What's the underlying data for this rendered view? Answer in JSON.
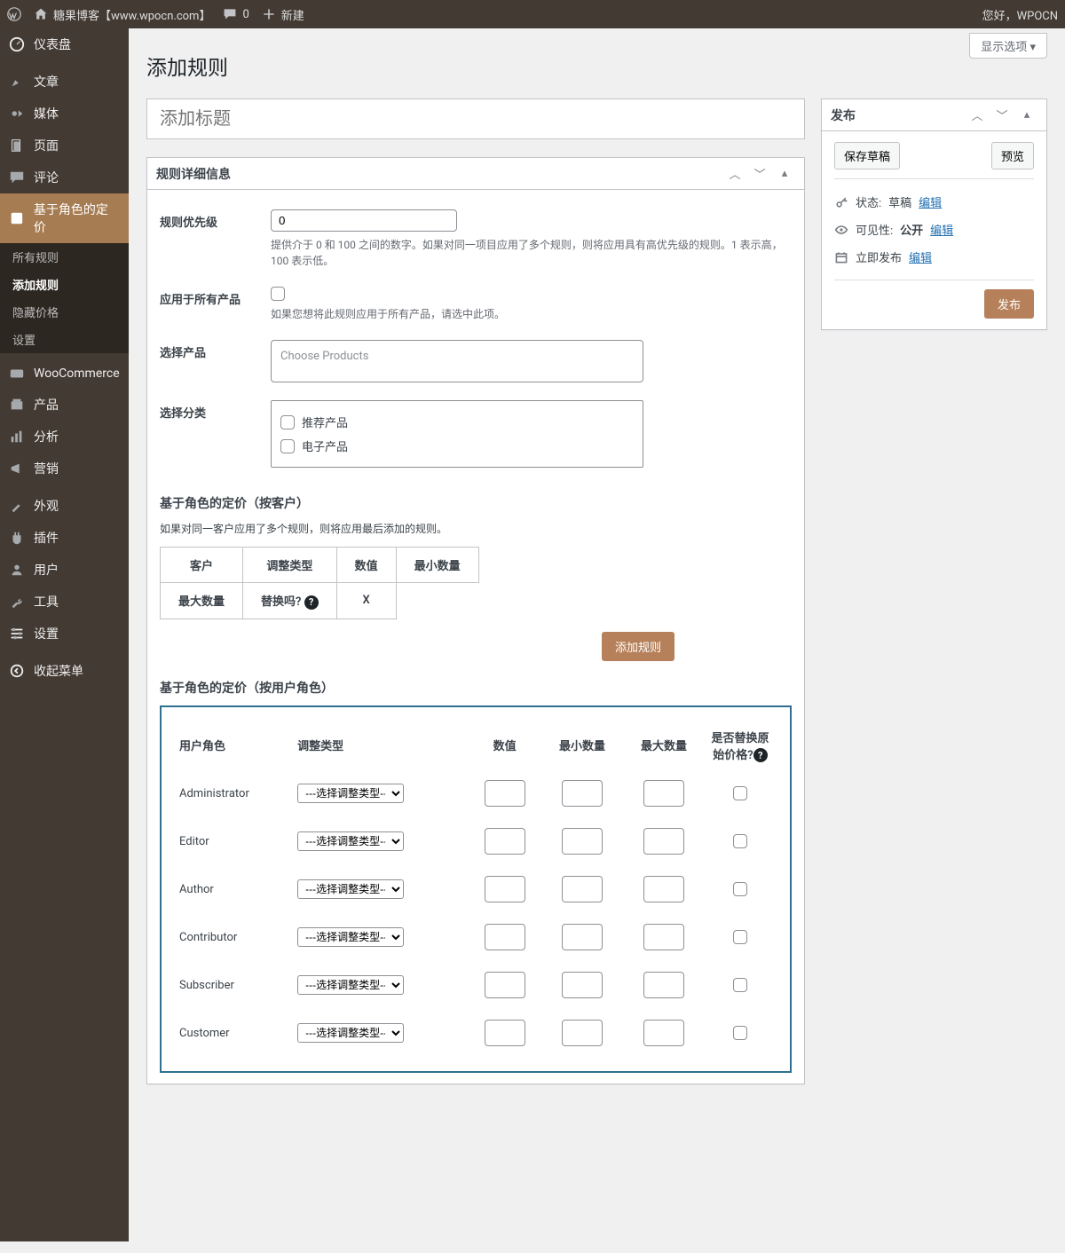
{
  "adminbar": {
    "site": "糖果博客【www.wpocn.com】",
    "comments": "0",
    "new": "新建",
    "hello": "您好，WPOCN"
  },
  "menu": {
    "dashboard": "仪表盘",
    "posts": "文章",
    "media": "媒体",
    "pages": "页面",
    "comments": "评论",
    "role_pricing": "基于角色的定价",
    "sub_all": "所有规则",
    "sub_add": "添加规则",
    "sub_hide": "隐藏价格",
    "sub_settings": "设置",
    "woocommerce": "WooCommerce",
    "products": "产品",
    "analytics": "分析",
    "marketing": "营销",
    "appearance": "外观",
    "plugins": "插件",
    "users": "用户",
    "tools": "工具",
    "settings": "设置",
    "collapse": "收起菜单"
  },
  "header": {
    "screen_options": "显示选项",
    "page_title": "添加规则",
    "title_placeholder": "添加标题"
  },
  "details": {
    "box_title": "规则详细信息",
    "priority_label": "规则优先级",
    "priority_value": "0",
    "priority_desc": "提供介于 0 和 100 之间的数字。如果对同一项目应用了多个规则，则将应用具有高优先级的规则。1 表示高，100 表示低。",
    "allprod_label": "应用于所有产品",
    "allprod_desc": "如果您想将此规则应用于所有产品，请选中此项。",
    "choose_prod_label": "选择产品",
    "choose_prod_placeholder": "Choose Products",
    "choose_cat_label": "选择分类",
    "cat1": "推荐产品",
    "cat2": "电子产品"
  },
  "by_customer": {
    "heading": "基于角色的定价（按客户）",
    "hint": "如果对同一客户应用了多个规则，则将应用最后添加的规则。",
    "col_customer": "客户",
    "col_adjtype": "调整类型",
    "col_value": "数值",
    "col_minqty": "最小数量",
    "col_maxqty": "最大数量",
    "col_replace": "替换吗?",
    "col_x": "X",
    "add_rule_btn": "添加规则"
  },
  "by_role": {
    "heading": "基于角色的定价（按用户角色）",
    "col_role": "用户角色",
    "col_adjtype": "调整类型",
    "col_value": "数值",
    "col_minqty": "最小数量",
    "col_maxqty": "最大数量",
    "col_replace": "是否替换原始价格?",
    "sel_placeholder": "---选择调整类型---",
    "roles": {
      "administrator": "Administrator",
      "editor": "Editor",
      "author": "Author",
      "contributor": "Contributor",
      "subscriber": "Subscriber",
      "customer": "Customer"
    }
  },
  "publish": {
    "box_title": "发布",
    "save_draft": "保存草稿",
    "preview": "预览",
    "status_lbl": "状态:",
    "status_val": "草稿",
    "vis_lbl": "可见性:",
    "vis_val": "公开",
    "sched_lbl": "立即发布",
    "edit": "编辑",
    "publish_btn": "发布"
  }
}
